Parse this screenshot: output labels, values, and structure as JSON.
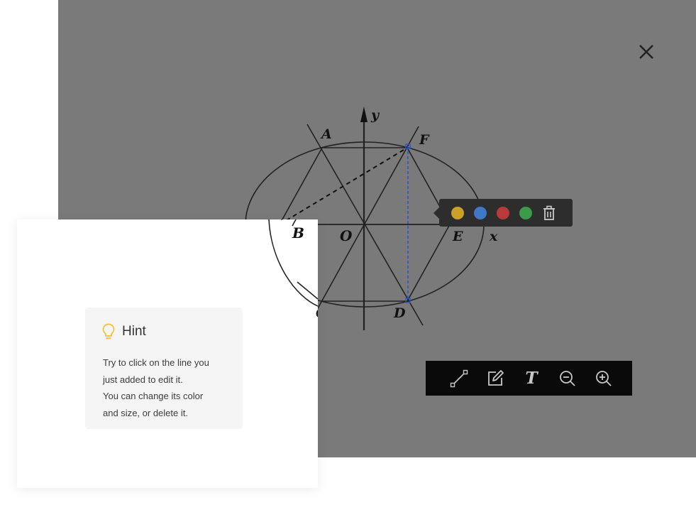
{
  "viewer": {
    "close_icon": "close-icon",
    "figure_labels": {
      "y_axis": "y",
      "x_axis": "x",
      "origin": "O",
      "A": "A",
      "B": "B",
      "C": "C",
      "D": "D",
      "E": "E",
      "F": "F"
    }
  },
  "edit_popover": {
    "colors": [
      {
        "name": "yellow",
        "hex": "#c9a02a"
      },
      {
        "name": "blue",
        "hex": "#3f79c6"
      },
      {
        "name": "red",
        "hex": "#b83a3a"
      },
      {
        "name": "green",
        "hex": "#3d9a4a"
      }
    ],
    "delete_icon": "trash-icon"
  },
  "toolbar": {
    "tools": [
      "line-tool-icon",
      "edit-icon",
      "text-tool-icon",
      "zoom-out-icon",
      "zoom-in-icon"
    ],
    "text_tool_glyph": "T"
  },
  "hint": {
    "icon": "lightbulb-icon",
    "title": "Hint",
    "lines": [
      "Try to click on the line you",
      "just added to edit it.",
      "You can change its color",
      "and size, or delete it."
    ]
  },
  "colors": {
    "viewer_bg": "#7a7a7a",
    "popover_bg": "#2d2d2d",
    "toolbar_bg": "#0a0a0a",
    "hint_bulb": "#f2c12e",
    "selected_line": "#2b56c9"
  }
}
